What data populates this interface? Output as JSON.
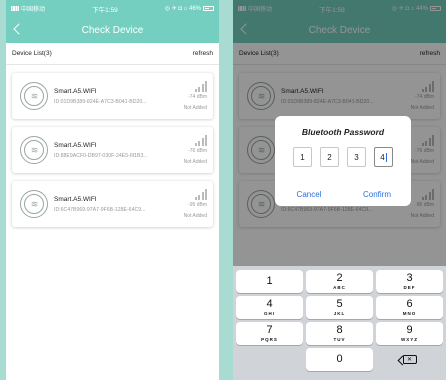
{
  "status_bar": {
    "carrier": "中国移动",
    "time": "下午1:59",
    "right_left_phone": "◎ ✈ ◘ ⌂ 46%",
    "right_right_phone": "◎ ✈ ◘ ⌂ 44%"
  },
  "nav": {
    "title": "Check Device"
  },
  "list": {
    "header": "Device List(3)",
    "refresh_label": "refresh"
  },
  "devices": [
    {
      "name": "Smart.A5.WIFI",
      "id": "ID:01D9B389-824E-A7C3-B041-BD20...",
      "signal": "-74 dBm",
      "status": "Not Added"
    },
    {
      "name": "Smart.A5.WIFI",
      "id": "ID:88E9ACF0-DB97-030F-24E5-6f1B3...",
      "signal": "-76 dBm",
      "status": "Not Added"
    },
    {
      "name": "Smart.A5.WIFI",
      "id": "ID:6C47B969-97A7-9F6B-128E-64C9...",
      "signal": "-95 dBm",
      "status": "Not Added"
    }
  ],
  "dialog": {
    "title": "Bluetooth Password",
    "digits": [
      "1",
      "2",
      "3",
      "4"
    ],
    "cancel_label": "Cancel",
    "confirm_label": "Confirm"
  },
  "keyboard": {
    "keys": [
      {
        "num": "1",
        "letters": ""
      },
      {
        "num": "2",
        "letters": "ABC"
      },
      {
        "num": "3",
        "letters": "DEF"
      },
      {
        "num": "4",
        "letters": "GHI"
      },
      {
        "num": "5",
        "letters": "JKL"
      },
      {
        "num": "6",
        "letters": "MNO"
      },
      {
        "num": "7",
        "letters": "PQRS"
      },
      {
        "num": "8",
        "letters": "TUV"
      },
      {
        "num": "9",
        "letters": "WXYZ"
      },
      {
        "num": "0",
        "letters": ""
      }
    ]
  },
  "colors": {
    "accent": "#74cfc0",
    "link": "#2b6fe0",
    "background": "#a8dcd2"
  },
  "icons": [
    "back-chevron-icon",
    "heater-waves-icon",
    "signal-bars-icon",
    "delete-key-icon"
  ]
}
